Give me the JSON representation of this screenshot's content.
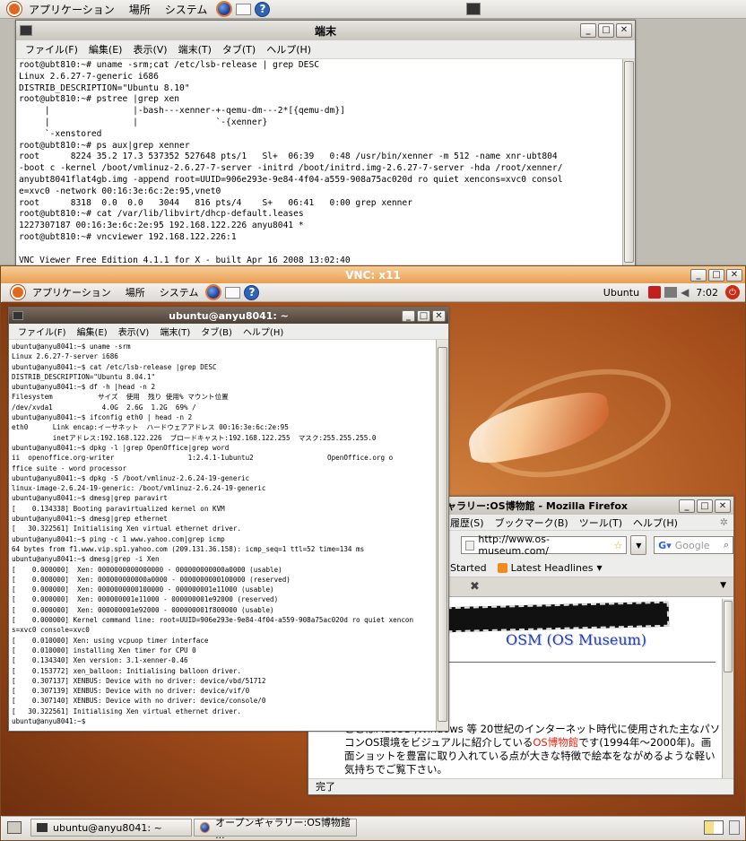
{
  "top_panel": {
    "menus": [
      "アプリケーション",
      "場所",
      "システム"
    ]
  },
  "host_terminal": {
    "title": "端末",
    "menu": [
      "ファイル(F)",
      "編集(E)",
      "表示(V)",
      "端末(T)",
      "タブ(T)",
      "ヘルプ(H)"
    ],
    "lines": "root@ubt810:~# uname -srm;cat /etc/lsb-release | grep DESC\nLinux 2.6.27-7-generic i686\nDISTRIB_DESCRIPTION=\"Ubuntu 8.10\"\nroot@ubt810:~# pstree |grep xen\n     |                |-bash---xenner-+-qemu-dm---2*[{qemu-dm}]\n     |                |               `-{xenner}\n     `-xenstored\nroot@ubt810:~# ps aux|grep xenner\nroot      8224 35.2 17.3 537352 527648 pts/1   Sl+  06:39   0:48 /usr/bin/xenner -m 512 -name xnr-ubt804\n-boot c -kernel /boot/vmlinuz-2.6.27-7-server -initrd /boot/initrd.img-2.6.27-7-server -hda /root/xenner/\nanyubt8041flat4gb.img -append root=UUID=906e293e-9e84-4f04-a559-908a75ac020d ro quiet xencons=xvc0 consol\ne=xvc0 -network 00:16:3e:6c:2e:95,vnet0\nroot      8318  0.0  0.0   3044   816 pts/4    S+   06:41   0:00 grep xenner\nroot@ubt810:~# cat /var/lib/libvirt/dhcp-default.leases\n1227307187 00:16:3e:6c:2e:95 192.168.122.226 anyu8041 *\nroot@ubt810:~# vncviewer 192.168.122.226:1\n\nVNC Viewer Free Edition 4.1.1 for X - built Apr 16 2008 13:02:40"
  },
  "vnc_window": {
    "title": "VNC: x11",
    "guest_panel": {
      "menus": [
        "アプリケーション",
        "場所",
        "システム"
      ],
      "user": "Ubuntu",
      "clock": "7:02"
    },
    "guest_terminal": {
      "title": "ubuntu@anyu8041: ~",
      "menu": [
        "ファイル(F)",
        "編集(E)",
        "表示(V)",
        "端末(T)",
        "タブ(B)",
        "ヘルプ(H)"
      ],
      "lines": "ubuntu@anyu8041:~$ uname -srm\nLinux 2.6.27-7-server i686\nubuntu@anyu8041:~$ cat /etc/lsb-release |grep DESC\nDISTRIB_DESCRIPTION=\"Ubuntu 8.04.1\"\nubuntu@anyu8041:~$ df -h |head -n 2\nFilesystem           サイズ  使用  残り 使用% マウント位置\n/dev/xvda1            4.0G  2.6G  1.2G  69% /\nubuntu@anyu8041:~$ ifconfig eth0 | head -n 2\neth0      Link encap:イーサネット  ハードウェアアドレス 00:16:3e:6c:2e:95\n          inetアドレス:192.168.122.226  ブロードキャスト:192.168.122.255  マスク:255.255.255.0\nubuntu@anyu8041:~$ dpkg -l |grep OpenOffice|grep word\nii  openoffice.org-writer                  1:2.4.1-1ubuntu2                  OpenOffice.org o\nffice suite - word processor\nubuntu@anyu8041:~$ dpkg -S /boot/vmlinuz-2.6.24-19-generic\nlinux-image-2.6.24-19-generic: /boot/vmlinuz-2.6.24-19-generic\nubuntu@anyu8041:~$ dmesg|grep paravirt\n[    0.134338] Booting paravirtualized kernel on KVM\nubuntu@anyu8041:~$ dmesg|grep ethernet\n[   30.322561] Initialising Xen virtual ethernet driver.\nubuntu@anyu8041:~$ ping -c 1 www.yahoo.com|grep icmp\n64 bytes from f1.www.vip.sp1.yahoo.com (209.131.36.158): icmp_seq=1 ttl=52 time=134 ms\nubuntu@anyu8041:~$ dmesg|grep -i Xen\n[    0.000000]  Xen: 0000000000000000 - 000000000000a0000 (usable)\n[    0.000000]  Xen: 000000000000a0000 - 0000000000100000 (reserved)\n[    0.000000]  Xen: 0000000000100000 - 000000001e11000 (usable)\n[    0.000000]  Xen: 000000001e11000 - 000000001e92000 (reserved)\n[    0.000000]  Xen: 000000001e92000 - 000000001f800000 (usable)\n[    0.000000] Kernel command line: root=UUID=906e293e-9e84-4f04-a559-908a75ac020d ro quiet xencon\ns=xvc0 console=xvc0\n[    0.010000] Xen: using vcpuop timer interface\n[    0.010000] installing Xen timer for CPU 0\n[    0.134340] Xen version: 3.1-xenner-0.46\n[    0.153772] xen_balloon: Initialising balloon driver.\n[    0.307137] XENBUS: Device with no driver: device/vbd/51712\n[    0.307139] XENBUS: Device with no driver: device/vif/0\n[    0.307140] XENBUS: Device with no driver: device/console/0\n[   30.322561] Initialising Xen virtual ethernet driver.\nubuntu@anyu8041:~$ "
    },
    "firefox": {
      "title": "ャラリー:OS博物館 - Mozilla Firefox",
      "menu": [
        "履歴(S)",
        "ブックマーク(B)",
        "ツール(T)",
        "ヘルプ(H)"
      ],
      "url": "http://www.os-museum.com/",
      "search_placeholder": "Google",
      "bookmarks": [
        "Started",
        "Latest Headlines"
      ],
      "logo_text": "OSM (OS Museum)",
      "body_pre": "ここはMacOS ,Windows 等 20世紀のインターネット時代に使用された主なパソコンOS環境をビジュアルに紹介している",
      "body_link": "OS博物館",
      "body_post": "です(1994年〜2000年)。画面ショットを豊富に取り入れている点が大きな特徴で絵本をながめるような軽い気持ちでご覧下さい。",
      "status": "完了"
    },
    "taskbar": [
      "ubuntu@anyu8041: ~",
      "オープンギャラリー:OS博物館 ..."
    ]
  },
  "colors": {
    "ubuntu_orange": "#e3661f",
    "link_red": "#e8220f",
    "logo_blue": "#1f3fb8"
  }
}
